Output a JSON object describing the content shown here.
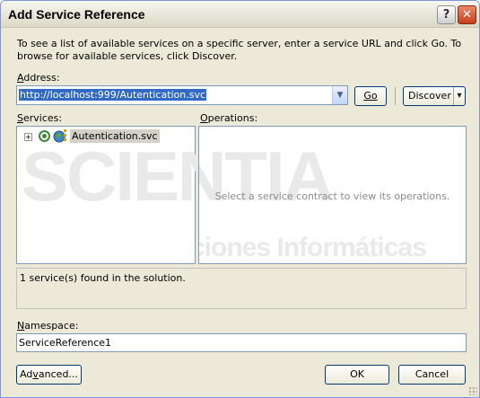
{
  "window": {
    "title": "Add Service Reference",
    "help_symbol": "?",
    "close_symbol": "✕"
  },
  "description": "To see a list of available services on a specific server, enter a service URL and click Go. To browse for available services, click Discover.",
  "address": {
    "label_prefix": "",
    "label_access": "A",
    "label_rest": "ddress:",
    "value": "http://localhost:999/Autentication.svc",
    "dropdown_symbol": "▼"
  },
  "buttons": {
    "go": "Go",
    "discover": "Discover",
    "discover_arrow": "▾",
    "advanced_pre": "Ad",
    "advanced_access": "v",
    "advanced_post": "anced...",
    "ok": "OK",
    "cancel": "Cancel"
  },
  "services": {
    "label_access": "S",
    "label_rest": "ervices:",
    "items": [
      {
        "label": "Autentication.svc",
        "expander": "+"
      }
    ]
  },
  "operations": {
    "label_access": "O",
    "label_rest": "perations:",
    "empty_message": "Select a service contract to view its operations."
  },
  "watermark": {
    "main": "SCIENTIA",
    "sub": "Soluciones Informáticas"
  },
  "status": "1 service(s) found in the solution.",
  "namespace": {
    "label_access": "N",
    "label_rest": "amespace:",
    "value": "ServiceReference1"
  },
  "colors": {
    "accent": "#316ac5",
    "dialog_bg": "#ece9d8",
    "field_border": "#7f9db9"
  }
}
